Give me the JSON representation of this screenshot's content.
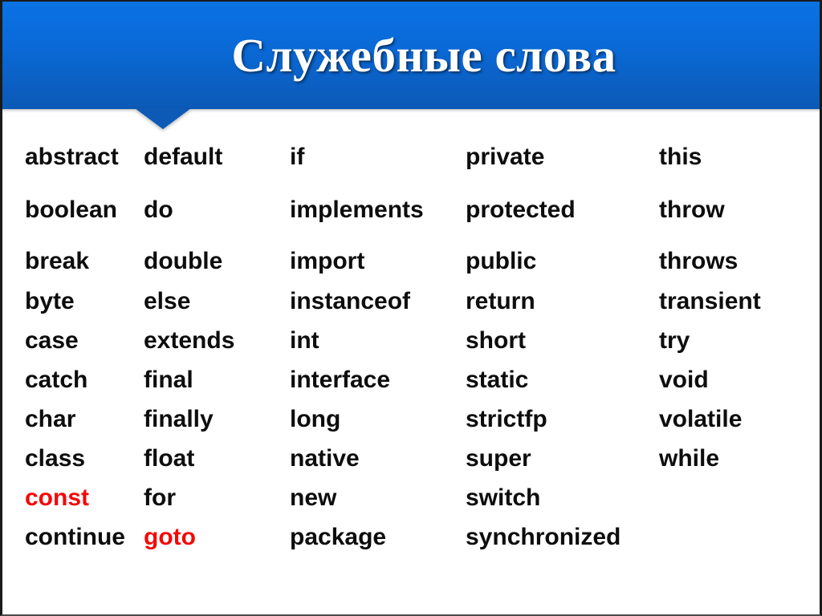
{
  "slide": {
    "title": "Служебные слова",
    "background_color": "#ffffff",
    "banner_gradient_top": "#0a72e4",
    "banner_gradient_bottom": "#0c5ab6",
    "title_color": "#ffffff",
    "keyword_color": "#0d0d0d",
    "highlight_color": "#f40808"
  },
  "keywords": {
    "columns": [
      {
        "items": [
          {
            "text": "abstract",
            "highlight": false
          },
          {
            "text": "boolean",
            "highlight": false
          },
          {
            "text": "break",
            "highlight": false
          },
          {
            "text": "byte",
            "highlight": false
          },
          {
            "text": "case",
            "highlight": false
          },
          {
            "text": "catch",
            "highlight": false
          },
          {
            "text": "char",
            "highlight": false
          },
          {
            "text": "class",
            "highlight": false
          },
          {
            "text": "const",
            "highlight": true
          },
          {
            "text": "continue",
            "highlight": false
          }
        ]
      },
      {
        "items": [
          {
            "text": "default",
            "highlight": false
          },
          {
            "text": "do",
            "highlight": false
          },
          {
            "text": "double",
            "highlight": false
          },
          {
            "text": "else",
            "highlight": false
          },
          {
            "text": "extends",
            "highlight": false
          },
          {
            "text": "final",
            "highlight": false
          },
          {
            "text": "finally",
            "highlight": false
          },
          {
            "text": "float",
            "highlight": false
          },
          {
            "text": "for",
            "highlight": false
          },
          {
            "text": "goto",
            "highlight": true
          }
        ]
      },
      {
        "items": [
          {
            "text": "if",
            "highlight": false
          },
          {
            "text": "implements",
            "highlight": false
          },
          {
            "text": "import",
            "highlight": false
          },
          {
            "text": "instanceof",
            "highlight": false
          },
          {
            "text": "int",
            "highlight": false
          },
          {
            "text": "interface",
            "highlight": false
          },
          {
            "text": "long",
            "highlight": false
          },
          {
            "text": "native",
            "highlight": false
          },
          {
            "text": "new",
            "highlight": false
          },
          {
            "text": "package",
            "highlight": false
          }
        ]
      },
      {
        "items": [
          {
            "text": "private",
            "highlight": false
          },
          {
            "text": "protected",
            "highlight": false
          },
          {
            "text": "public",
            "highlight": false
          },
          {
            "text": "return",
            "highlight": false
          },
          {
            "text": "short",
            "highlight": false
          },
          {
            "text": "static",
            "highlight": false
          },
          {
            "text": "strictfp",
            "highlight": false
          },
          {
            "text": "super",
            "highlight": false
          },
          {
            "text": "switch",
            "highlight": false
          },
          {
            "text": "synchronized",
            "highlight": false
          }
        ]
      },
      {
        "items": [
          {
            "text": "this",
            "highlight": false
          },
          {
            "text": "throw",
            "highlight": false
          },
          {
            "text": "throws",
            "highlight": false
          },
          {
            "text": "transient",
            "highlight": false
          },
          {
            "text": "try",
            "highlight": false
          },
          {
            "text": "void",
            "highlight": false
          },
          {
            "text": "volatile",
            "highlight": false
          },
          {
            "text": "while",
            "highlight": false
          }
        ]
      }
    ]
  }
}
